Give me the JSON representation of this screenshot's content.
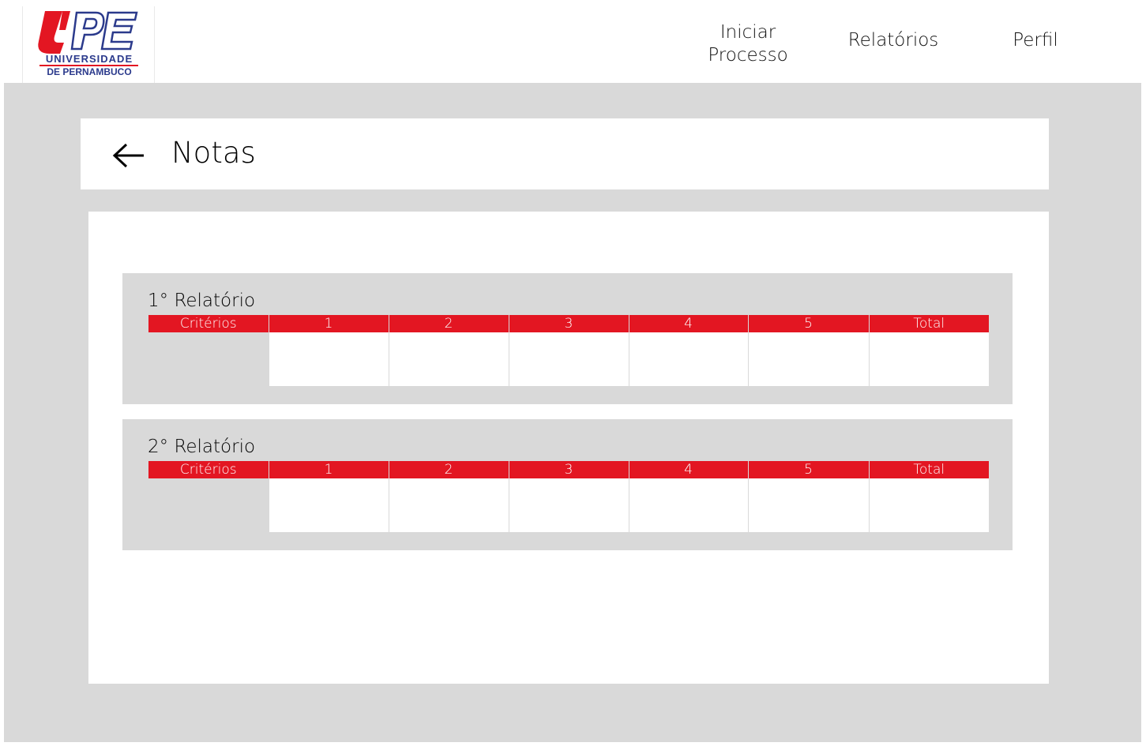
{
  "logo": {
    "name": "UPE",
    "line1": "UNIVERSIDADE",
    "line2": "DE PERNAMBUCO",
    "colors": {
      "red": "#e31622",
      "blue": "#2b3a8c"
    }
  },
  "nav": {
    "iniciar_processo": "Iniciar\nProcesso",
    "relatorios": "Relatórios",
    "perfil": "Perfil"
  },
  "page": {
    "back_icon": "arrow-left-icon",
    "title": "Notas"
  },
  "reports": [
    {
      "title": "1° Relatório",
      "columns": [
        "Critérios",
        "1",
        "2",
        "3",
        "4",
        "5",
        "Total"
      ],
      "rows": [
        [
          "",
          "",
          "",
          "",
          "",
          "",
          ""
        ]
      ]
    },
    {
      "title": "2° Relatório",
      "columns": [
        "Critérios",
        "1",
        "2",
        "3",
        "4",
        "5",
        "Total"
      ],
      "rows": [
        [
          "",
          "",
          "",
          "",
          "",
          "",
          ""
        ]
      ]
    }
  ],
  "colors": {
    "accent": "#e31622",
    "background": "#d9d9d9",
    "card": "#ffffff"
  }
}
